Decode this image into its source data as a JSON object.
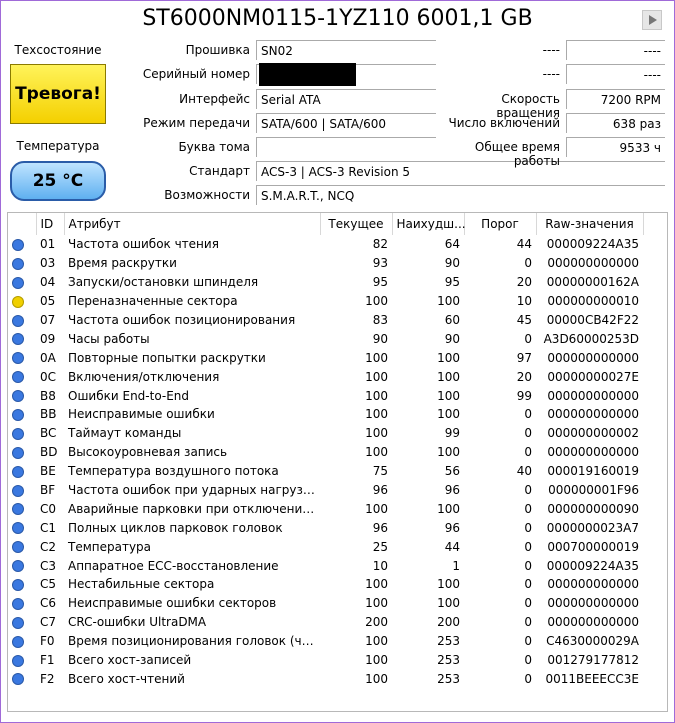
{
  "drive_title": "ST6000NM0115-1YZ110 6001,1 GB",
  "health": {
    "label": "Техсостояние",
    "status": "Тревога!",
    "color": "#f6d800"
  },
  "temperature": {
    "label": "Температура",
    "value": "25 °C",
    "color": "#7cc0f5"
  },
  "info_left": {
    "firmware": {
      "label": "Прошивка",
      "value": "SN02"
    },
    "serial": {
      "label": "Серийный номер",
      "value": ""
    },
    "interface": {
      "label": "Интерфейс",
      "value": "Serial ATA"
    },
    "transfer_mode": {
      "label": "Режим передачи",
      "value": "SATA/600 | SATA/600"
    },
    "drive_letter": {
      "label": "Буква тома",
      "value": ""
    },
    "standard": {
      "label": "Стандарт",
      "value": "ACS-3 | ACS-3 Revision 5"
    },
    "features": {
      "label": "Возможности",
      "value": "S.M.A.R.T., NCQ"
    }
  },
  "info_right": {
    "blank1": {
      "label": "----",
      "value": "----"
    },
    "blank2": {
      "label": "----",
      "value": "----"
    },
    "rotation": {
      "label": "Скорость вращения",
      "value": "7200 RPM"
    },
    "power_count": {
      "label": "Число включений",
      "value": "638 раз"
    },
    "power_hours": {
      "label": "Общее время работы",
      "value": "9533 ч"
    }
  },
  "table": {
    "headers": {
      "id": "ID",
      "attr": "Атрибут",
      "current": "Текущее",
      "worst": "Наихудш...",
      "threshold": "Порог",
      "raw": "Raw-значения"
    },
    "status_colors": {
      "good": "#3a78e0",
      "caution": "#f0d000"
    },
    "rows": [
      {
        "status": "good",
        "id": "01",
        "attr": "Частота ошибок чтения",
        "current": "82",
        "worst": "64",
        "threshold": "44",
        "raw": "000009224A35"
      },
      {
        "status": "good",
        "id": "03",
        "attr": "Время раскрутки",
        "current": "93",
        "worst": "90",
        "threshold": "0",
        "raw": "000000000000"
      },
      {
        "status": "good",
        "id": "04",
        "attr": "Запуски/остановки шпинделя",
        "current": "95",
        "worst": "95",
        "threshold": "20",
        "raw": "00000000162A"
      },
      {
        "status": "caution",
        "id": "05",
        "attr": "Переназначенные сектора",
        "current": "100",
        "worst": "100",
        "threshold": "10",
        "raw": "000000000010"
      },
      {
        "status": "good",
        "id": "07",
        "attr": "Частота ошибок позиционирования",
        "current": "83",
        "worst": "60",
        "threshold": "45",
        "raw": "00000CB42F22"
      },
      {
        "status": "good",
        "id": "09",
        "attr": "Часы работы",
        "current": "90",
        "worst": "90",
        "threshold": "0",
        "raw": "A3D60000253D"
      },
      {
        "status": "good",
        "id": "0A",
        "attr": "Повторные попытки раскрутки",
        "current": "100",
        "worst": "100",
        "threshold": "97",
        "raw": "000000000000"
      },
      {
        "status": "good",
        "id": "0C",
        "attr": "Включения/отключения",
        "current": "100",
        "worst": "100",
        "threshold": "20",
        "raw": "00000000027E"
      },
      {
        "status": "good",
        "id": "B8",
        "attr": "Ошибки End-to-End",
        "current": "100",
        "worst": "100",
        "threshold": "99",
        "raw": "000000000000"
      },
      {
        "status": "good",
        "id": "BB",
        "attr": "Неисправимые ошибки",
        "current": "100",
        "worst": "100",
        "threshold": "0",
        "raw": "000000000000"
      },
      {
        "status": "good",
        "id": "BC",
        "attr": "Таймаут команды",
        "current": "100",
        "worst": "99",
        "threshold": "0",
        "raw": "000000000002"
      },
      {
        "status": "good",
        "id": "BD",
        "attr": "Высокоуровневая запись",
        "current": "100",
        "worst": "100",
        "threshold": "0",
        "raw": "000000000000"
      },
      {
        "status": "good",
        "id": "BE",
        "attr": "Температура воздушного потока",
        "current": "75",
        "worst": "56",
        "threshold": "40",
        "raw": "000019160019"
      },
      {
        "status": "good",
        "id": "BF",
        "attr": "Частота ошибок при ударных нагрузках",
        "current": "96",
        "worst": "96",
        "threshold": "0",
        "raw": "000000001F96"
      },
      {
        "status": "good",
        "id": "C0",
        "attr": "Аварийные парковки при отключении пи...",
        "current": "100",
        "worst": "100",
        "threshold": "0",
        "raw": "000000000090"
      },
      {
        "status": "good",
        "id": "C1",
        "attr": "Полных циклов парковок головок",
        "current": "96",
        "worst": "96",
        "threshold": "0",
        "raw": "0000000023A7"
      },
      {
        "status": "good",
        "id": "C2",
        "attr": "Температура",
        "current": "25",
        "worst": "44",
        "threshold": "0",
        "raw": "000700000019"
      },
      {
        "status": "good",
        "id": "C3",
        "attr": "Аппаратное ECC-восстановление",
        "current": "10",
        "worst": "1",
        "threshold": "0",
        "raw": "000009224A35"
      },
      {
        "status": "good",
        "id": "C5",
        "attr": "Нестабильные сектора",
        "current": "100",
        "worst": "100",
        "threshold": "0",
        "raw": "000000000000"
      },
      {
        "status": "good",
        "id": "C6",
        "attr": "Неисправимые ошибки секторов",
        "current": "100",
        "worst": "100",
        "threshold": "0",
        "raw": "000000000000"
      },
      {
        "status": "good",
        "id": "C7",
        "attr": "CRC-ошибки UltraDMA",
        "current": "200",
        "worst": "200",
        "threshold": "0",
        "raw": "000000000000"
      },
      {
        "status": "good",
        "id": "F0",
        "attr": "Время позиционирования головок (часы)",
        "current": "100",
        "worst": "253",
        "threshold": "0",
        "raw": "C4630000029A"
      },
      {
        "status": "good",
        "id": "F1",
        "attr": "Всего хост-записей",
        "current": "100",
        "worst": "253",
        "threshold": "0",
        "raw": "001279177812"
      },
      {
        "status": "good",
        "id": "F2",
        "attr": "Всего хост-чтений",
        "current": "100",
        "worst": "253",
        "threshold": "0",
        "raw": "0011BEEECC3E"
      }
    ]
  }
}
